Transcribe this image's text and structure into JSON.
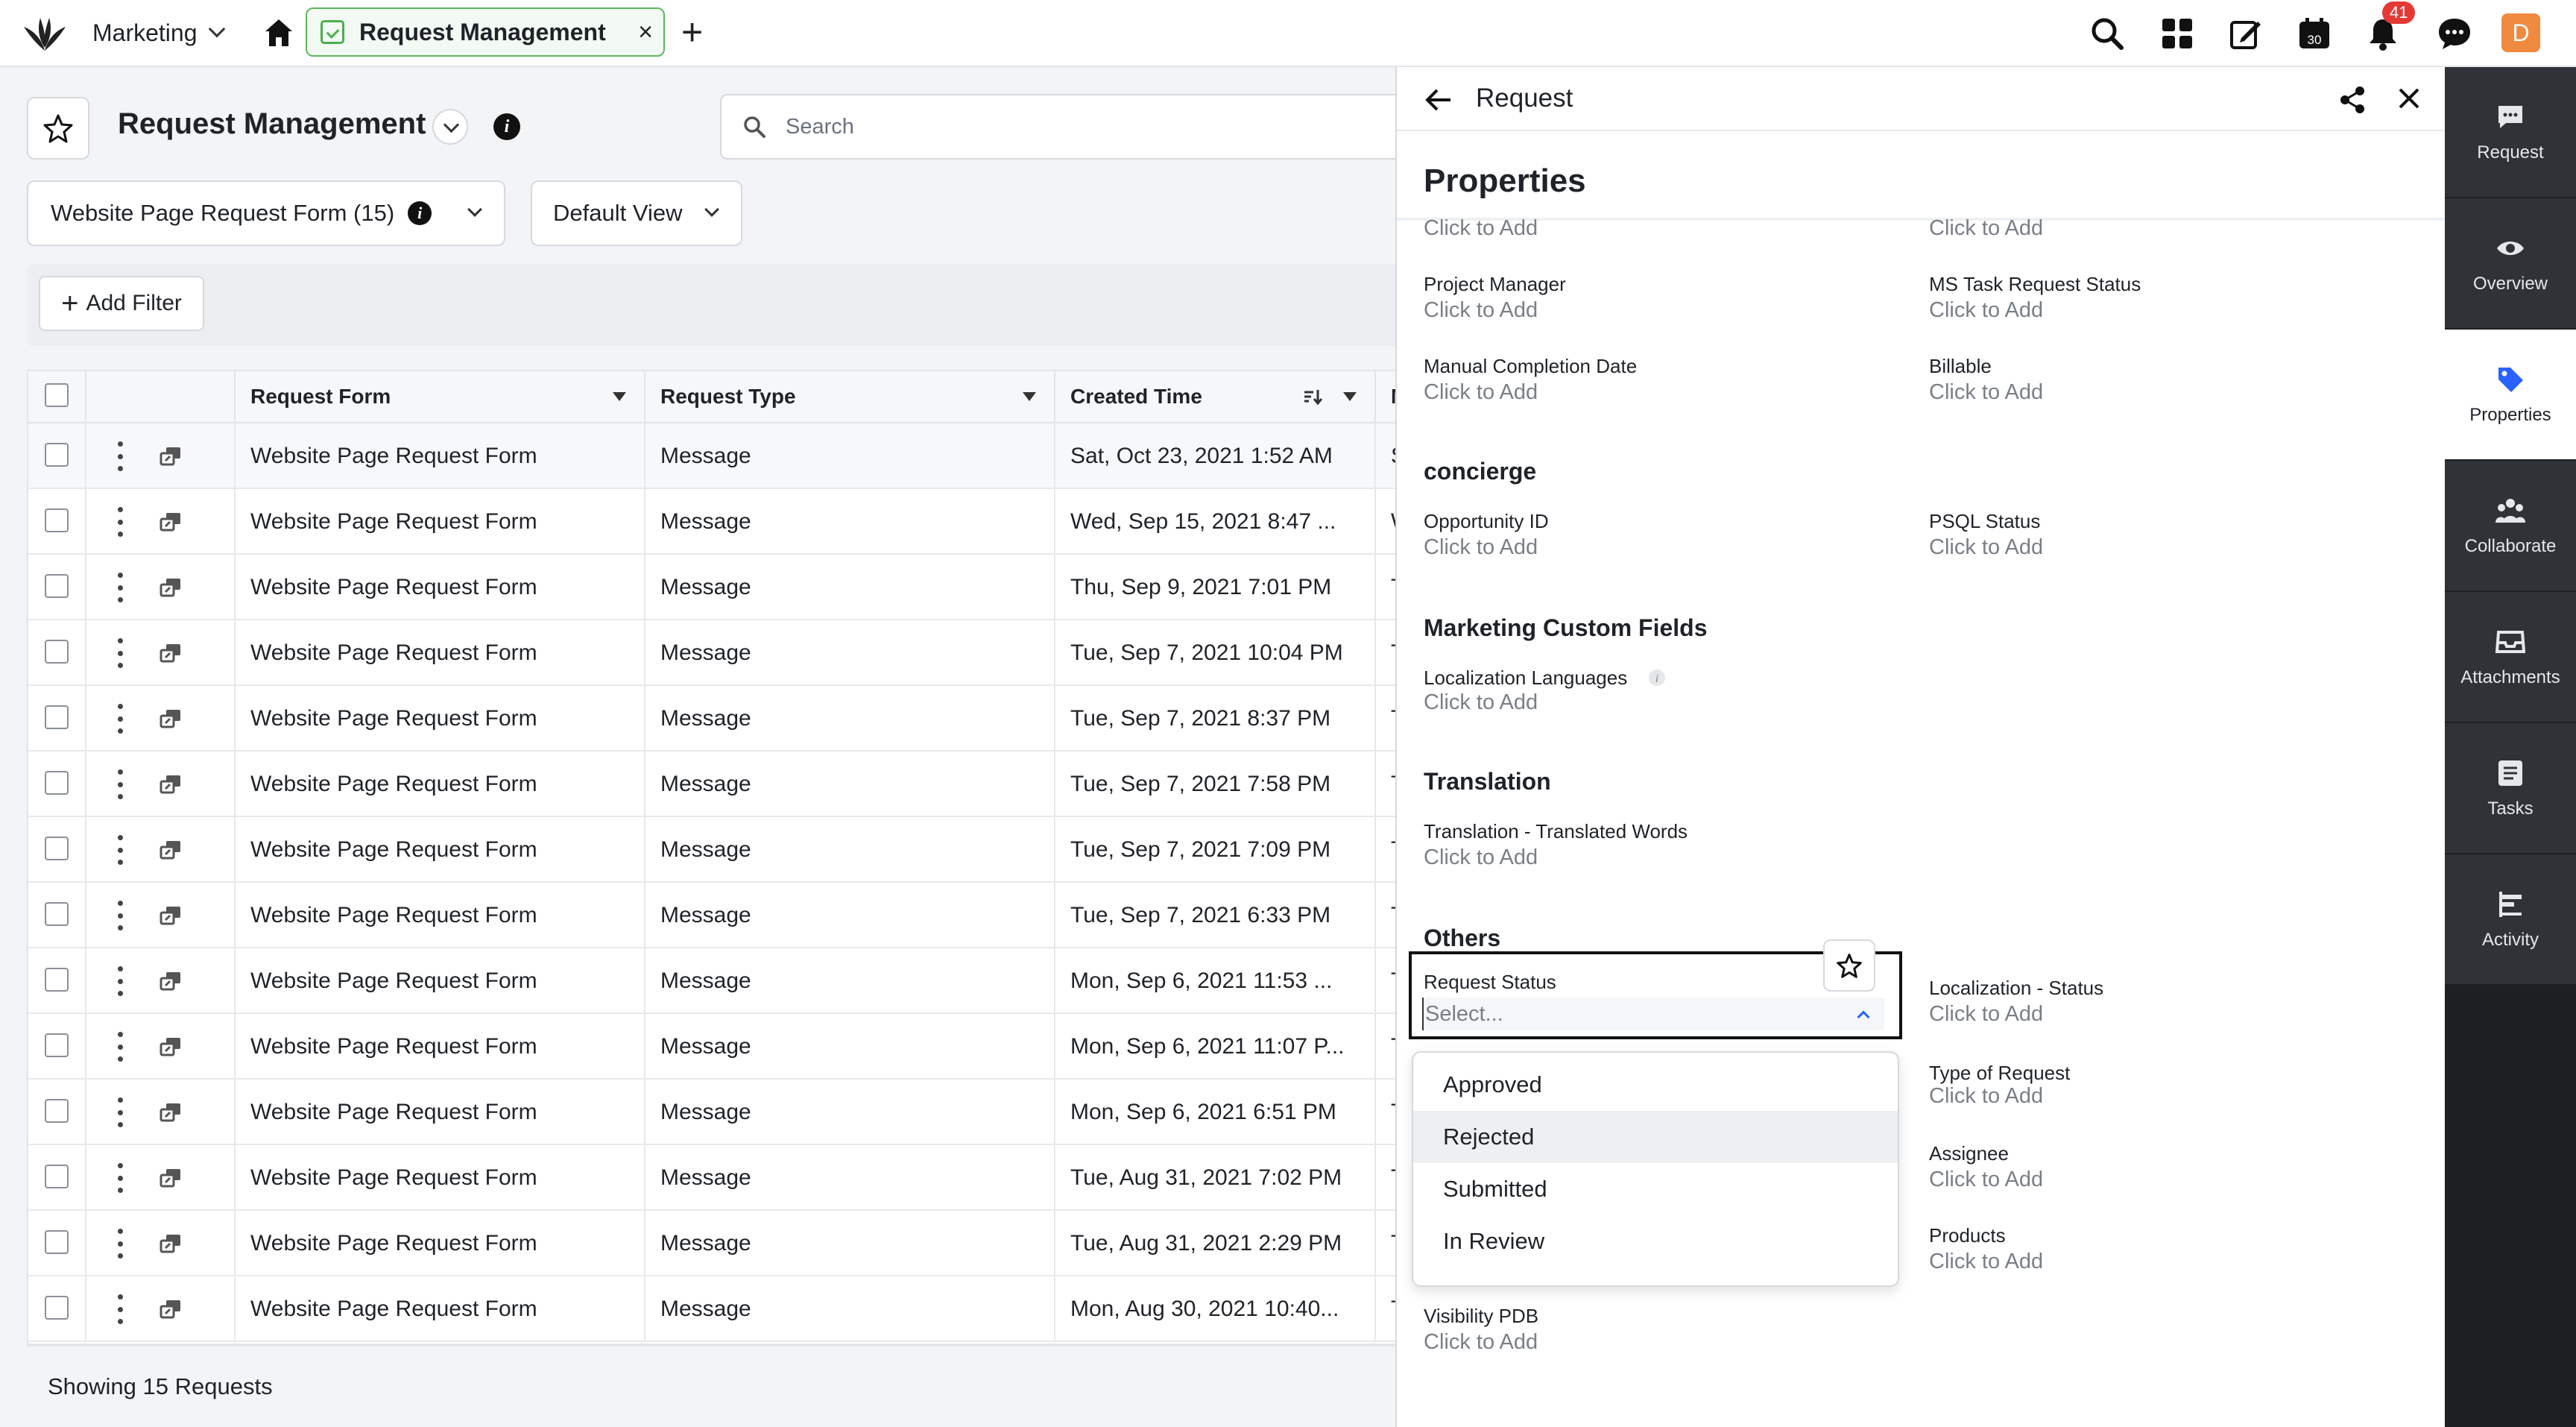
{
  "topbar": {
    "workspace": "Marketing",
    "tab_label": "Request Management",
    "tab_close": "×",
    "new_tab": "+",
    "notification_count": "41",
    "avatar_initial": "D",
    "calendar_day": "30"
  },
  "page": {
    "title": "Request Management",
    "info": "i",
    "search_placeholder": "Search",
    "form_selector": "Website Page Request Form (15)",
    "view_selector": "Default View",
    "add_filter": "Add Filter",
    "footer": "Showing 15 Requests"
  },
  "table": {
    "columns": [
      "Request Form",
      "Request Type",
      "Created Time",
      "Mod"
    ],
    "rows": [
      [
        "Website Page Request Form",
        "Message",
        "Sat, Oct 23, 2021 1:52 AM",
        "Sat"
      ],
      [
        "Website Page Request Form",
        "Message",
        "Wed, Sep 15, 2021 8:47 ...",
        "Wed"
      ],
      [
        "Website Page Request Form",
        "Message",
        "Thu, Sep 9, 2021 7:01 PM",
        "Thu"
      ],
      [
        "Website Page Request Form",
        "Message",
        "Tue, Sep 7, 2021 10:04 PM",
        "Tue"
      ],
      [
        "Website Page Request Form",
        "Message",
        "Tue, Sep 7, 2021 8:37 PM",
        "Tue"
      ],
      [
        "Website Page Request Form",
        "Message",
        "Tue, Sep 7, 2021 7:58 PM",
        "Tue"
      ],
      [
        "Website Page Request Form",
        "Message",
        "Tue, Sep 7, 2021 7:09 PM",
        "Tue"
      ],
      [
        "Website Page Request Form",
        "Message",
        "Tue, Sep 7, 2021 6:33 PM",
        "Tue"
      ],
      [
        "Website Page Request Form",
        "Message",
        "Mon, Sep 6, 2021 11:53 ...",
        "Tue"
      ],
      [
        "Website Page Request Form",
        "Message",
        "Mon, Sep 6, 2021 11:07 P...",
        "Tue"
      ],
      [
        "Website Page Request Form",
        "Message",
        "Mon, Sep 6, 2021 6:51 PM",
        "Tue"
      ],
      [
        "Website Page Request Form",
        "Message",
        "Tue, Aug 31, 2021 7:02 PM",
        "Tue"
      ],
      [
        "Website Page Request Form",
        "Message",
        "Tue, Aug 31, 2021 2:29 PM",
        "Tue"
      ],
      [
        "Website Page Request Form",
        "Message",
        "Mon, Aug 30, 2021 10:40...",
        "Tue"
      ]
    ]
  },
  "panel": {
    "title": "Request",
    "heading": "Properties",
    "click_to_add": "Click to Add",
    "fields": {
      "project_manager": "Project Manager",
      "ms_task_status": "MS Task Request Status",
      "manual_completion": "Manual Completion Date",
      "billable": "Billable",
      "opportunity_id": "Opportunity ID",
      "psql_status": "PSQL Status",
      "localization_languages": "Localization Languages",
      "translated_words": "Translation - Translated Words",
      "request_status": "Request Status",
      "localization_status": "Localization - Status",
      "type_of_request": "Type of Request",
      "assignee": "Assignee",
      "products": "Products",
      "visibility_pdb": "Visibility PDB"
    },
    "sections": {
      "concierge": "concierge",
      "marketing": "Marketing Custom Fields",
      "translation": "Translation",
      "others": "Others"
    },
    "select_placeholder": "Select...",
    "options": [
      "Approved",
      "Rejected",
      "Submitted",
      "In Review"
    ]
  },
  "rail": {
    "items": [
      "Request",
      "Overview",
      "Properties",
      "Collaborate",
      "Attachments",
      "Tasks",
      "Activity"
    ]
  },
  "colors": {
    "accent": "#2962ff",
    "tab_green": "#4caf50",
    "badge_red": "#e53935",
    "avatar_orange": "#f08a3e"
  }
}
